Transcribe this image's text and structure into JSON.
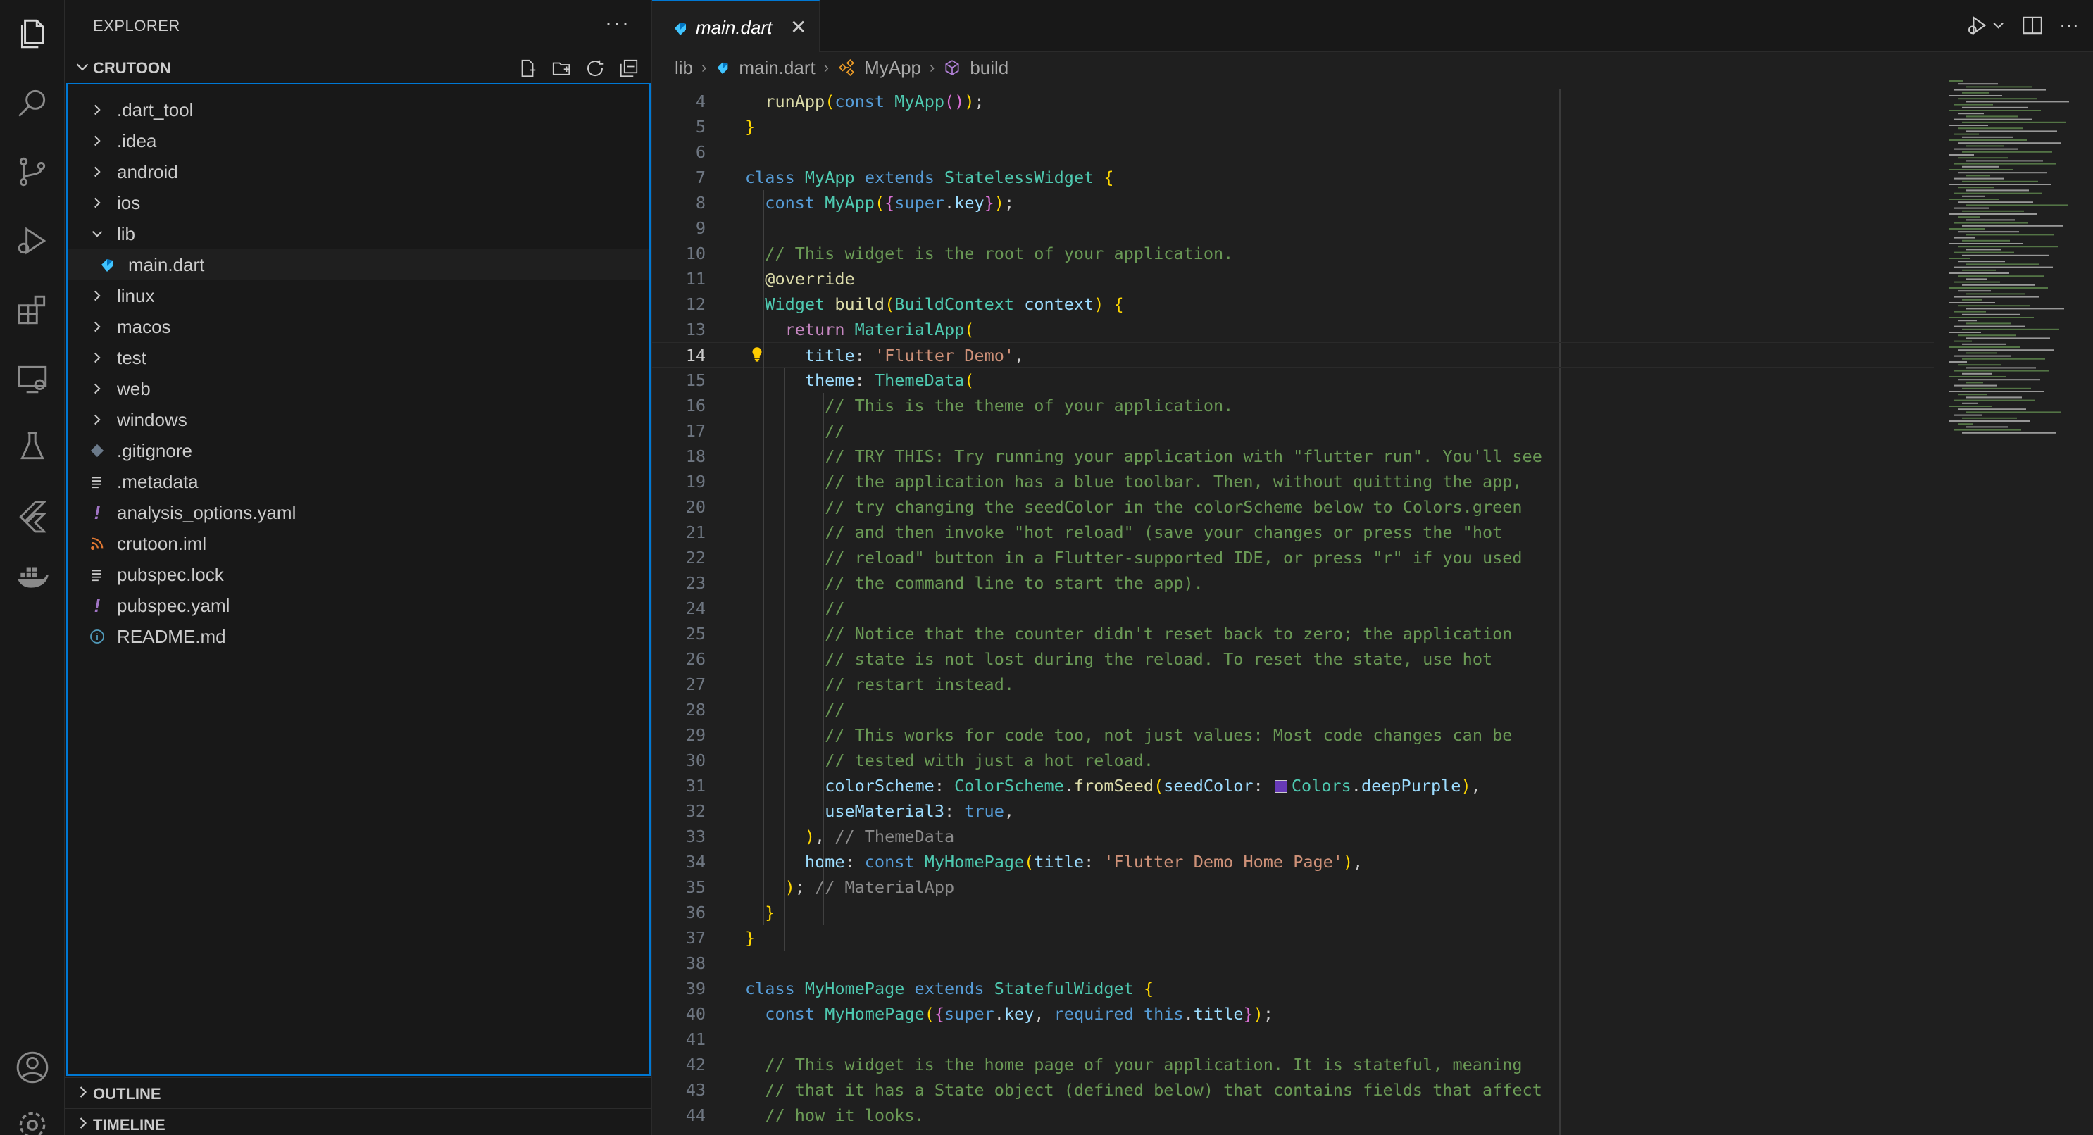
{
  "sidebar": {
    "title": "EXPLORER",
    "more": "···",
    "project": "CRUTOON",
    "items": [
      {
        "label": ".dart_tool",
        "kind": "folder"
      },
      {
        "label": ".idea",
        "kind": "folder"
      },
      {
        "label": "android",
        "kind": "folder"
      },
      {
        "label": "ios",
        "kind": "folder"
      },
      {
        "label": "lib",
        "kind": "folder-open"
      },
      {
        "label": "main.dart",
        "kind": "dart"
      },
      {
        "label": "linux",
        "kind": "folder"
      },
      {
        "label": "macos",
        "kind": "folder"
      },
      {
        "label": "test",
        "kind": "folder"
      },
      {
        "label": "web",
        "kind": "folder"
      },
      {
        "label": "windows",
        "kind": "folder"
      },
      {
        "label": ".gitignore",
        "kind": "git"
      },
      {
        "label": ".metadata",
        "kind": "lines"
      },
      {
        "label": "analysis_options.yaml",
        "kind": "yaml"
      },
      {
        "label": "crutoon.iml",
        "kind": "rss"
      },
      {
        "label": "pubspec.lock",
        "kind": "lines"
      },
      {
        "label": "pubspec.yaml",
        "kind": "yaml"
      },
      {
        "label": "README.md",
        "kind": "info"
      }
    ],
    "outline": "OUTLINE",
    "timeline": "TIMELINE"
  },
  "tab": {
    "name": "main.dart",
    "close": "✕"
  },
  "breadcrumb": {
    "lib": "lib",
    "file": "main.dart",
    "cls": "MyApp",
    "method": "build",
    "sep": "›"
  },
  "editor": {
    "current_line": "14",
    "lines": [
      {
        "n": "4",
        "t": "  runApp(const MyApp());"
      },
      {
        "n": "5",
        "t": "}"
      },
      {
        "n": "6",
        "t": ""
      },
      {
        "n": "7",
        "t": "class MyApp extends StatelessWidget {"
      },
      {
        "n": "8",
        "t": "  const MyApp({super.key});"
      },
      {
        "n": "9",
        "t": ""
      },
      {
        "n": "10",
        "t": "  // This widget is the root of your application."
      },
      {
        "n": "11",
        "t": "  @override"
      },
      {
        "n": "12",
        "t": "  Widget build(BuildContext context) {"
      },
      {
        "n": "13",
        "t": "    return MaterialApp("
      },
      {
        "n": "14",
        "t": "      title: 'Flutter Demo',"
      },
      {
        "n": "15",
        "t": "      theme: ThemeData("
      },
      {
        "n": "16",
        "t": "        // This is the theme of your application."
      },
      {
        "n": "17",
        "t": "        //"
      },
      {
        "n": "18",
        "t": "        // TRY THIS: Try running your application with \"flutter run\". You'll see"
      },
      {
        "n": "19",
        "t": "        // the application has a blue toolbar. Then, without quitting the app,"
      },
      {
        "n": "20",
        "t": "        // try changing the seedColor in the colorScheme below to Colors.green"
      },
      {
        "n": "21",
        "t": "        // and then invoke \"hot reload\" (save your changes or press the \"hot"
      },
      {
        "n": "22",
        "t": "        // reload\" button in a Flutter-supported IDE, or press \"r\" if you used"
      },
      {
        "n": "23",
        "t": "        // the command line to start the app)."
      },
      {
        "n": "24",
        "t": "        //"
      },
      {
        "n": "25",
        "t": "        // Notice that the counter didn't reset back to zero; the application"
      },
      {
        "n": "26",
        "t": "        // state is not lost during the reload. To reset the state, use hot"
      },
      {
        "n": "27",
        "t": "        // restart instead."
      },
      {
        "n": "28",
        "t": "        //"
      },
      {
        "n": "29",
        "t": "        // This works for code too, not just values: Most code changes can be"
      },
      {
        "n": "30",
        "t": "        // tested with just a hot reload."
      },
      {
        "n": "31",
        "t": "        colorScheme: ColorScheme.fromSeed(seedColor: Colors.deepPurple),"
      },
      {
        "n": "32",
        "t": "        useMaterial3: true,"
      },
      {
        "n": "33",
        "t": "      ), // ThemeData"
      },
      {
        "n": "34",
        "t": "      home: const MyHomePage(title: 'Flutter Demo Home Page'),"
      },
      {
        "n": "35",
        "t": "    ); // MaterialApp"
      },
      {
        "n": "36",
        "t": "  }"
      },
      {
        "n": "37",
        "t": "}"
      },
      {
        "n": "38",
        "t": ""
      },
      {
        "n": "39",
        "t": "class MyHomePage extends StatefulWidget {"
      },
      {
        "n": "40",
        "t": "  const MyHomePage({super.key, required this.title});"
      },
      {
        "n": "41",
        "t": ""
      },
      {
        "n": "42",
        "t": "  // This widget is the home page of your application. It is stateful, meaning"
      },
      {
        "n": "43",
        "t": "  // that it has a State object (defined below) that contains fields that affect"
      },
      {
        "n": "44",
        "t": "  // how it looks."
      }
    ]
  },
  "colors": {
    "accent": "#0078d4",
    "deepPurple": "#673ab7"
  }
}
